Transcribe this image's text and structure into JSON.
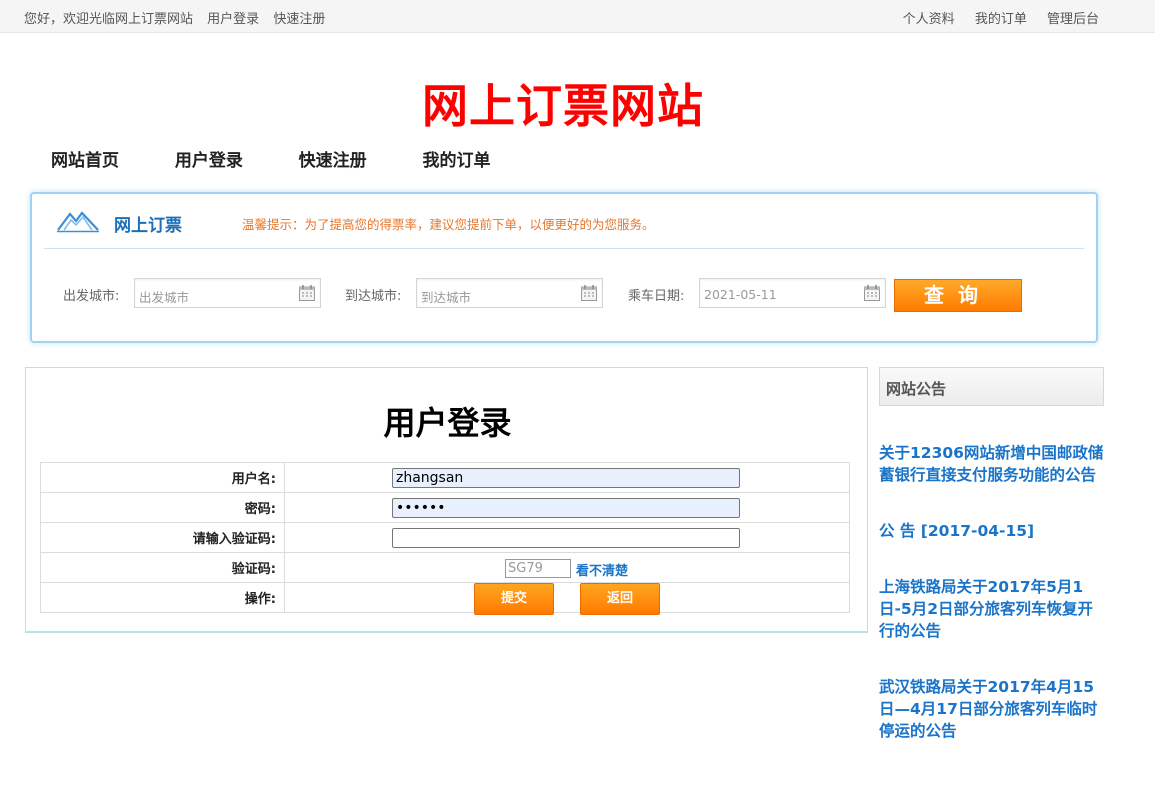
{
  "topbar": {
    "welcome": "您好，欢迎光临网上订票网站",
    "login": "用户登录",
    "register": "快速注册",
    "profile": "个人资料",
    "orders": "我的订单",
    "admin": "管理后台"
  },
  "site_title": "网上订票网站",
  "nav": [
    "网站首页",
    "用户登录",
    "快速注册",
    "我的订单"
  ],
  "booking": {
    "title": "网上订票",
    "tip": "温馨提示：为了提高您的得票率，建议您提前下单，以便更好的为您服务。",
    "from_label": "出发城市:",
    "from_placeholder": "出发城市",
    "to_label": "到达城市:",
    "to_placeholder": "到达城市",
    "date_label": "乘车日期:",
    "date_value": "2021-05-11",
    "query_button": "查询",
    "logo_icon": "mountain-logo-icon",
    "calendar_icon": "calendar-icon"
  },
  "login": {
    "title": "用户登录",
    "username_label": "用户名:",
    "username_value": "zhangsan",
    "password_label": "密码:",
    "password_value": "••••••",
    "captcha_input_label": "请输入验证码:",
    "captcha_input_value": "",
    "captcha_label": "验证码:",
    "captcha_code": "SG79",
    "captcha_refresh": "看不清楚",
    "action_label": "操作:",
    "submit": "提交",
    "back": "返回"
  },
  "notices": {
    "heading": "网站公告",
    "items": [
      "关于12306网站新增中国邮政储蓄银行直接支付服务功能的公告",
      "公 告 [2017-04-15]",
      "上海铁路局关于2017年5月1日-5月2日部分旅客列车恢复开行的公告",
      "武汉铁路局关于2017年4月15日—4月17日部分旅客列车临时停运的公告"
    ]
  },
  "colors": {
    "title_red": "#ff0000",
    "accent_blue": "#1a74c9",
    "button_orange": "#ff8a00",
    "tip_orange": "#e8762b"
  }
}
